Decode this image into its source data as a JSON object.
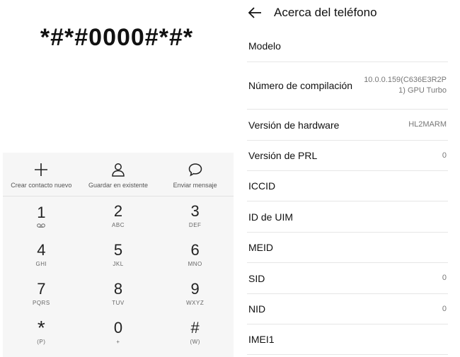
{
  "dialer": {
    "display_number": "*#*#0000#*#*",
    "actions": [
      {
        "label": "Crear contacto nuevo",
        "icon": "plus-icon"
      },
      {
        "label": "Guardar en existente",
        "icon": "person-icon"
      },
      {
        "label": "Enviar mensaje",
        "icon": "message-bubble-icon"
      }
    ],
    "keys": [
      {
        "digit": "1",
        "sub": "",
        "sub_icon": "voicemail-icon"
      },
      {
        "digit": "2",
        "sub": "ABC"
      },
      {
        "digit": "3",
        "sub": "DEF"
      },
      {
        "digit": "4",
        "sub": "GHI"
      },
      {
        "digit": "5",
        "sub": "JKL"
      },
      {
        "digit": "6",
        "sub": "MNO"
      },
      {
        "digit": "7",
        "sub": "PQRS"
      },
      {
        "digit": "8",
        "sub": "TUV"
      },
      {
        "digit": "9",
        "sub": "WXYZ"
      },
      {
        "digit": "*",
        "sub": "(P)"
      },
      {
        "digit": "0",
        "sub": "+"
      },
      {
        "digit": "#",
        "sub": "(W)"
      }
    ]
  },
  "about": {
    "title": "Acerca del teléfono",
    "back_icon": "back-arrow-icon",
    "rows": [
      {
        "label": "Modelo",
        "value": ""
      },
      {
        "label": "Número de compilación",
        "value": "10.0.0.159(C636E3R2P1) GPU Turbo"
      },
      {
        "label": "Versión de hardware",
        "value": "HL2MARM"
      },
      {
        "label": "Versión de PRL",
        "value": "0"
      },
      {
        "label": "ICCID",
        "value": ""
      },
      {
        "label": "ID de UIM",
        "value": ""
      },
      {
        "label": "MEID",
        "value": ""
      },
      {
        "label": "SID",
        "value": "0"
      },
      {
        "label": "NID",
        "value": "0"
      },
      {
        "label": "IMEI1",
        "value": ""
      }
    ]
  },
  "colors": {
    "dialer_panel_bg": "#f6f6f6",
    "divider": "#e6e6e6",
    "secondary_text": "#777777"
  }
}
